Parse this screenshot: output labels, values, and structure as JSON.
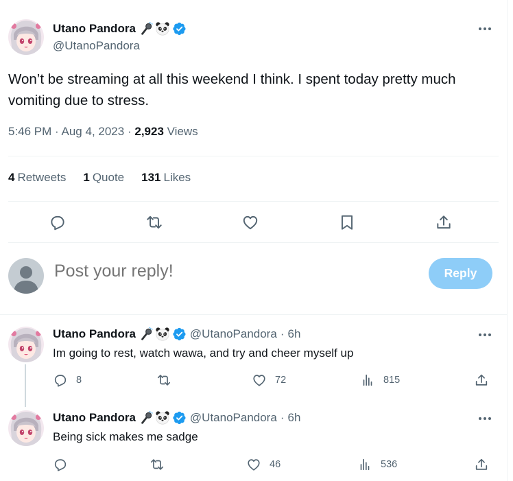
{
  "main_tweet": {
    "author": {
      "name": "Utano Pandora",
      "handle": "@UtanoPandora",
      "emoji_icons": [
        "microphone-icon",
        "panda-icon"
      ],
      "verified_icon": "verified-badge-icon"
    },
    "text": "Won’t be streaming at all this weekend I think. I spent today pretty much vomiting due to stress.",
    "time": "5:46 PM",
    "date": "Aug 4, 2023",
    "views_count": "2,923",
    "views_label": "Views",
    "separator": "·",
    "stats": {
      "retweets_count": "4",
      "retweets_label": "Retweets",
      "quotes_count": "1",
      "quotes_label": "Quote",
      "likes_count": "131",
      "likes_label": "Likes"
    },
    "action_icons": [
      "reply-icon",
      "retweet-icon",
      "like-icon",
      "bookmark-icon",
      "share-icon"
    ]
  },
  "reply_composer": {
    "placeholder": "Post your reply!",
    "button_label": "Reply",
    "button_color": "#8ecdf8"
  },
  "replies": [
    {
      "name": "Utano Pandora",
      "handle": "@UtanoPandora",
      "separator": "·",
      "age": "6h",
      "text": "Im going to rest, watch wawa, and try and cheer myself up",
      "reply_count": "8",
      "retweet_count": "",
      "like_count": "72",
      "view_count": "815"
    },
    {
      "name": "Utano Pandora",
      "handle": "@UtanoPandora",
      "separator": "·",
      "age": "6h",
      "text": "Being sick makes me sadge",
      "reply_count": "",
      "retweet_count": "",
      "like_count": "46",
      "view_count": "536"
    }
  ],
  "colors": {
    "text_primary": "#0f1419",
    "text_secondary": "#536471",
    "verified": "#1d9bf0",
    "divider": "#eff3f4",
    "thread_line": "#cfd9de"
  }
}
